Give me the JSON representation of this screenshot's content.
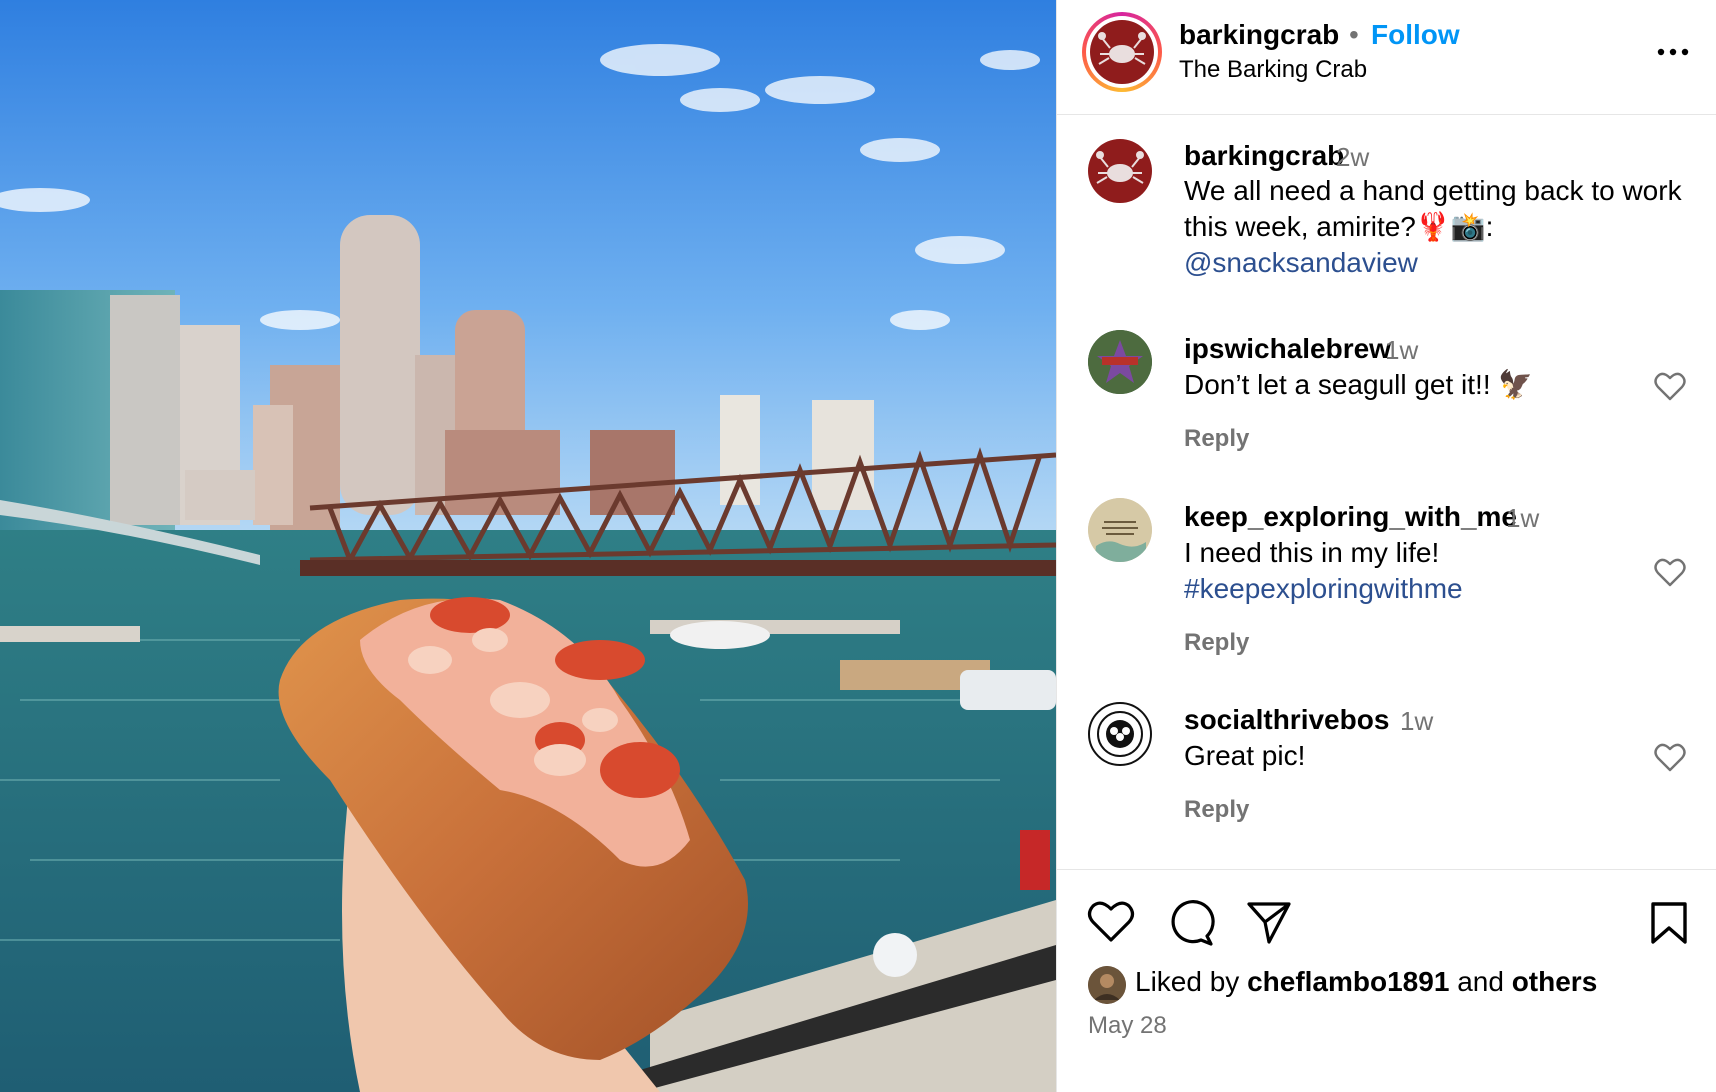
{
  "post": {
    "photo_alt": "Lobster roll held over Boston harbor",
    "header": {
      "username": "barkingcrab",
      "separator": "•",
      "follow_label": "Follow",
      "subtitle": "The Barking Crab"
    },
    "caption": {
      "username": "barkingcrab",
      "time": "2w",
      "text_line1": "We all need a hand getting back to work",
      "text_line2": "this week, amirite?🦞📸:",
      "mention": "@snacksandaview"
    },
    "comments": [
      {
        "username": "ipswichalebrew",
        "time": "1w",
        "text": "Don’t let a seagull get it!! 🦅",
        "reply": "Reply"
      },
      {
        "username": "keep_exploring_with_me",
        "time": "1w",
        "text": "I need this in my life!",
        "hashtag": "#keepexploringwithme",
        "reply": "Reply"
      },
      {
        "username": "socialthrivebos",
        "time": "1w",
        "text": "Great pic!",
        "reply": "Reply"
      }
    ],
    "likes": {
      "prefix": "Liked by",
      "user": "cheflambo1891",
      "connector": "and",
      "others": "others"
    },
    "date": "May 28",
    "colors": {
      "follow_blue": "#0095f6",
      "link_blue": "#2c4f8f",
      "muted": "#737373",
      "brand_red": "#8f1c1c"
    },
    "icons": [
      "more-icon",
      "heart-icon",
      "comment-icon",
      "share-icon",
      "bookmark-icon"
    ]
  }
}
